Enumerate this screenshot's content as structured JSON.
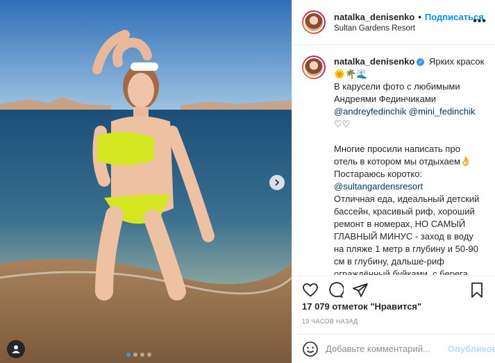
{
  "header": {
    "username": "natalka_denisenko",
    "separator": "•",
    "follow_label": "Подписаться",
    "location": "Sultan Gardens Resort",
    "more_label": "•••"
  },
  "caption": {
    "username": "natalka_denisenko",
    "verified_mark": "✓",
    "lines": {
      "l1": "Ярких красок",
      "l2": "🌞🌴🌊",
      "l3": "В карусели фото с любимыми Андреями Фединчиками",
      "mention1": "@andreyfedinchik",
      "mention2": "@mini_fedinchik",
      "hearts": "♡♡",
      "l4": "Многие просили написать про отель в котором мы отдыхаем👌",
      "l5": "Постараюсь коротко:",
      "mention3": "@sultangardensresort",
      "l6": "Отличная еда, идеальный детский бассейн, красивый риф, хороший ремонт в номерах, НО САМЫЙ ГЛАВНЫЙ МИНУС - заход в воду на пляже 1 метр в глубину и 50-90 см в глубину, дальше-риф ограждённый буйками, с берега купаться невозможно 👎 только окунаться 🤷 хотели переселиться в"
    }
  },
  "likes": "17 079 отметок \"Нравится\"",
  "timestamp": "19 часов назад",
  "comment": {
    "placeholder": "Добавьте комментарий...",
    "post_label": "Опубликовать"
  },
  "icons": {
    "like": "heart-icon",
    "comment": "comment-icon",
    "share": "share-icon",
    "save": "bookmark-icon",
    "emoji": "emoji-icon",
    "next": "chevron-right-icon",
    "user_tag": "user-icon"
  },
  "carousel": {
    "total": 4,
    "active": 1
  },
  "colors": {
    "accent": "#0095f6",
    "post_disabled": "#b2dffc",
    "text": "#262626",
    "muted": "#8e8e8e"
  }
}
